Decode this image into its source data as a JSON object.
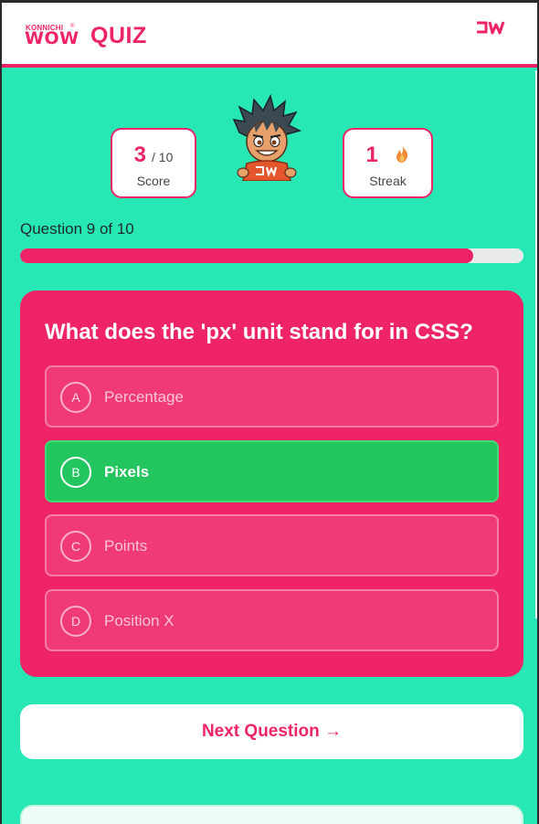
{
  "header": {
    "logo_top": "KONNICHI",
    "logo_bottom": "WOW",
    "title": "QUIZ",
    "brand_icon": "jw-monogram-icon"
  },
  "stats": {
    "score": {
      "value": "3",
      "total": "/ 10",
      "label": "Score"
    },
    "streak": {
      "value": "1",
      "icon": "fire-icon",
      "label": "Streak"
    }
  },
  "progress": {
    "label": "Question 9 of 10",
    "fraction": 0.9
  },
  "question": {
    "text": "What does the 'px' unit stand for in CSS?",
    "options": [
      {
        "letter": "A",
        "text": "Percentage",
        "state": "default"
      },
      {
        "letter": "B",
        "text": "Pixels",
        "state": "correct"
      },
      {
        "letter": "C",
        "text": "Points",
        "state": "default"
      },
      {
        "letter": "D",
        "text": "Position X",
        "state": "default"
      }
    ]
  },
  "actions": {
    "next_label": "Next Question →"
  },
  "colors": {
    "background": "#27e8b4",
    "accent": "#ef2466",
    "correct": "#22c55e"
  }
}
